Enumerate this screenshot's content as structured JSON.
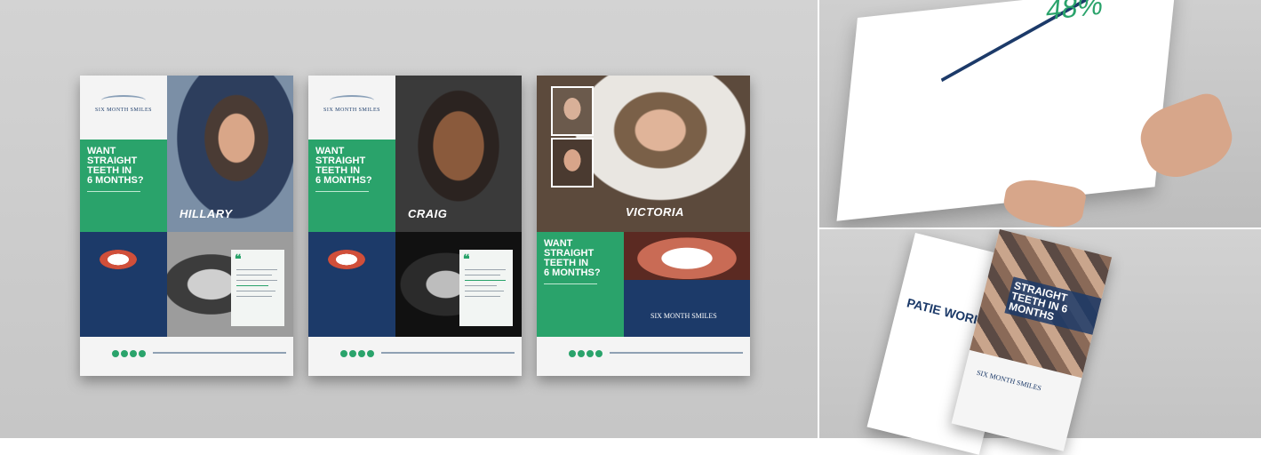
{
  "flyers": [
    {
      "headline_lines": [
        "WANT",
        "STRAIGHT",
        "TEETH IN",
        "6 MONTHS?"
      ],
      "name": "HILLARY",
      "logo": "SIX MONTH SMILES"
    },
    {
      "headline_lines": [
        "WANT",
        "STRAIGHT",
        "TEETH IN",
        "6 MONTHS?"
      ],
      "name": "CRAIG",
      "logo": "SIX MONTH SMILES"
    },
    {
      "headline_lines": [
        "WANT",
        "STRAIGHT",
        "TEETH IN",
        "6 MONTHS?"
      ],
      "name": "VICTORIA",
      "logo": "SIX MONTH SMILES"
    }
  ],
  "brochure_open": {
    "stat": "48%"
  },
  "brochure_closed": {
    "headline": "STRAIGHT TEETH IN 6 MONTHS",
    "logo": "SIX MONTH SMILES",
    "side_text": "PATIE WORI"
  },
  "colors": {
    "green": "#2aa36b",
    "navy": "#1c3a69"
  }
}
